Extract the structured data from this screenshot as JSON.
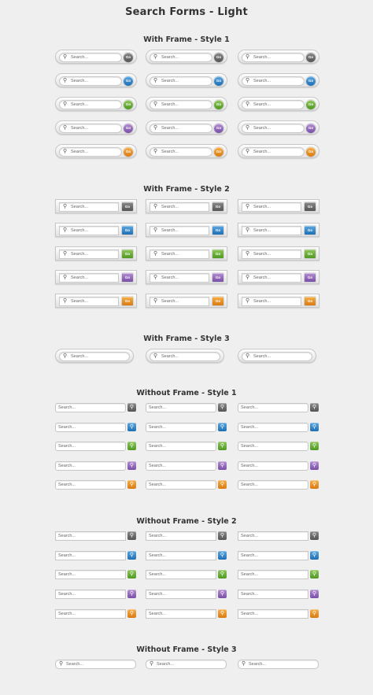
{
  "page_title": "Search Forms - Light",
  "placeholder": "Search...",
  "go_label": "Go",
  "colors": {
    "gray": "#666666",
    "blue": "#2f83c8",
    "green": "#62a834",
    "purple": "#8d5db8",
    "orange": "#e88a1a"
  },
  "sections": {
    "s1": {
      "title": "With Frame - Style 1"
    },
    "s2": {
      "title": "With Frame - Style 2"
    },
    "s3": {
      "title": "With Frame - Style 3"
    },
    "s4": {
      "title": "Without Frame - Style 1"
    },
    "s5": {
      "title": "Without Frame - Style 2"
    },
    "s6": {
      "title": "Without Frame - Style 3"
    }
  },
  "row_colors": [
    "gray",
    "blue",
    "green",
    "purple",
    "orange"
  ],
  "icons": {
    "search": "magnifier-icon"
  }
}
